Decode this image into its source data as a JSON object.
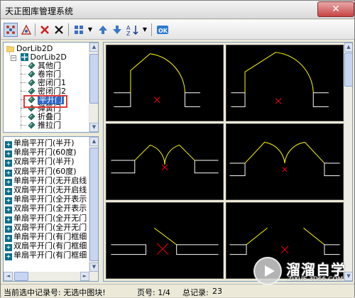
{
  "window": {
    "title": "天正图库管理系统",
    "close_label": "✕"
  },
  "toolbar": {
    "buttons": [
      {
        "name": "view-mode-icon"
      },
      {
        "name": "shape-icon"
      },
      {
        "name": "delete-red-icon"
      },
      {
        "name": "delete-black-icon"
      },
      {
        "name": "grid-view-icon"
      },
      {
        "name": "arrow-up-icon"
      },
      {
        "name": "arrow-down-icon"
      },
      {
        "name": "sort-az-icon"
      },
      {
        "name": "ok-icon",
        "label": "OK"
      }
    ]
  },
  "tree": {
    "root": "DorLib2D",
    "child": "DorLib2D",
    "items": [
      "其他门",
      "卷帘门",
      "密闭门1",
      "密闭门2",
      "平开门",
      "弹簧门",
      "折叠门",
      "推拉门"
    ],
    "selected": "平开门"
  },
  "list": {
    "items": [
      "单扇平开门(半开)",
      "单扇平开门(60度)",
      "双扇平开门(半开)",
      "双扇平开门(60度)",
      "单扇平开门(无开启线",
      "双扇平开门(无开启线",
      "单扇平开门(全开表示",
      "双扇平开门(全开表示",
      "单扇平开门(全开无门",
      "双扇平开门(全开无门",
      "单扇平开门(有门框细",
      "双扇平开门(有门框细",
      "单扇平开门(有门框细"
    ]
  },
  "status": {
    "current_record": "当前选中记录号: 无选中图块!",
    "page": "页号: 1/4",
    "total_label": "总记录:",
    "total": "23"
  },
  "watermark": {
    "title": "溜溜自学",
    "subtitle": "ZIXUE.3D66.COM"
  },
  "colors": {
    "preview_bg": "#000000",
    "door_arc": "#ffff00",
    "wall_line": "#ffffff",
    "mark": "#ff0000"
  }
}
